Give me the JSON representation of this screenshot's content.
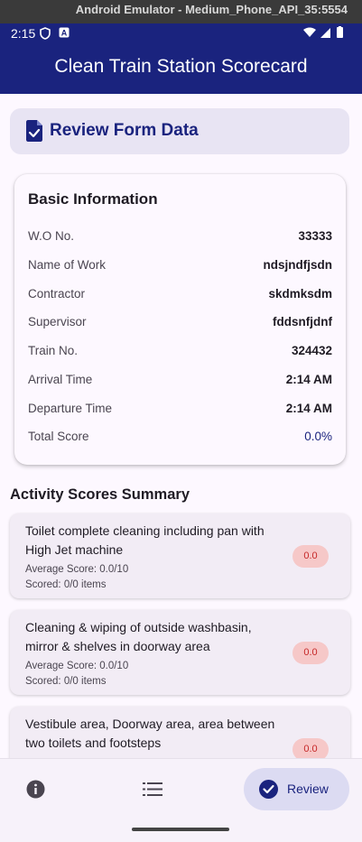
{
  "window": {
    "title": "Android Emulator - Medium_Phone_API_35:5554"
  },
  "status_bar": {
    "time": "2:15"
  },
  "app_bar": {
    "title": "Clean Train Station Scorecard"
  },
  "review_header": {
    "title": "Review Form Data",
    "icon": "document-check-icon"
  },
  "basic_info": {
    "title": "Basic Information",
    "rows": [
      {
        "label": "W.O No.",
        "value": "33333"
      },
      {
        "label": "Name of Work",
        "value": "ndsjndfjsdn"
      },
      {
        "label": "Contractor",
        "value": "skdmksdm"
      },
      {
        "label": "Supervisor",
        "value": "fddsnfjdnf"
      },
      {
        "label": "Train No.",
        "value": "324432"
      },
      {
        "label": "Arrival Time",
        "value": "2:14 AM"
      },
      {
        "label": "Departure Time",
        "value": "2:14 AM"
      },
      {
        "label": "Total Score",
        "value": "0.0%"
      }
    ]
  },
  "activity_summary": {
    "title": "Activity Scores Summary",
    "items": [
      {
        "name": "Toilet complete cleaning including pan with High Jet machine",
        "average": "Average Score: 0.0/10",
        "scored": "Scored: 0/0 items",
        "badge": "0.0"
      },
      {
        "name": "Cleaning & wiping of outside washbasin, mirror & shelves in doorway area",
        "average": "Average Score: 0.0/10",
        "scored": "Scored: 0/0 items",
        "badge": "0.0"
      },
      {
        "name": "Vestibule area, Doorway area, area between two toilets and footsteps",
        "average": "",
        "scored": "",
        "badge": "0.0"
      }
    ]
  },
  "bottom_nav": {
    "items": [
      {
        "icon": "info-icon"
      },
      {
        "icon": "list-icon"
      },
      {
        "icon": "check-circle-icon",
        "label": "Review"
      }
    ]
  },
  "colors": {
    "primary": "#1a237e",
    "badge_bg": "#f6c8c8",
    "badge_text": "#c62828"
  }
}
